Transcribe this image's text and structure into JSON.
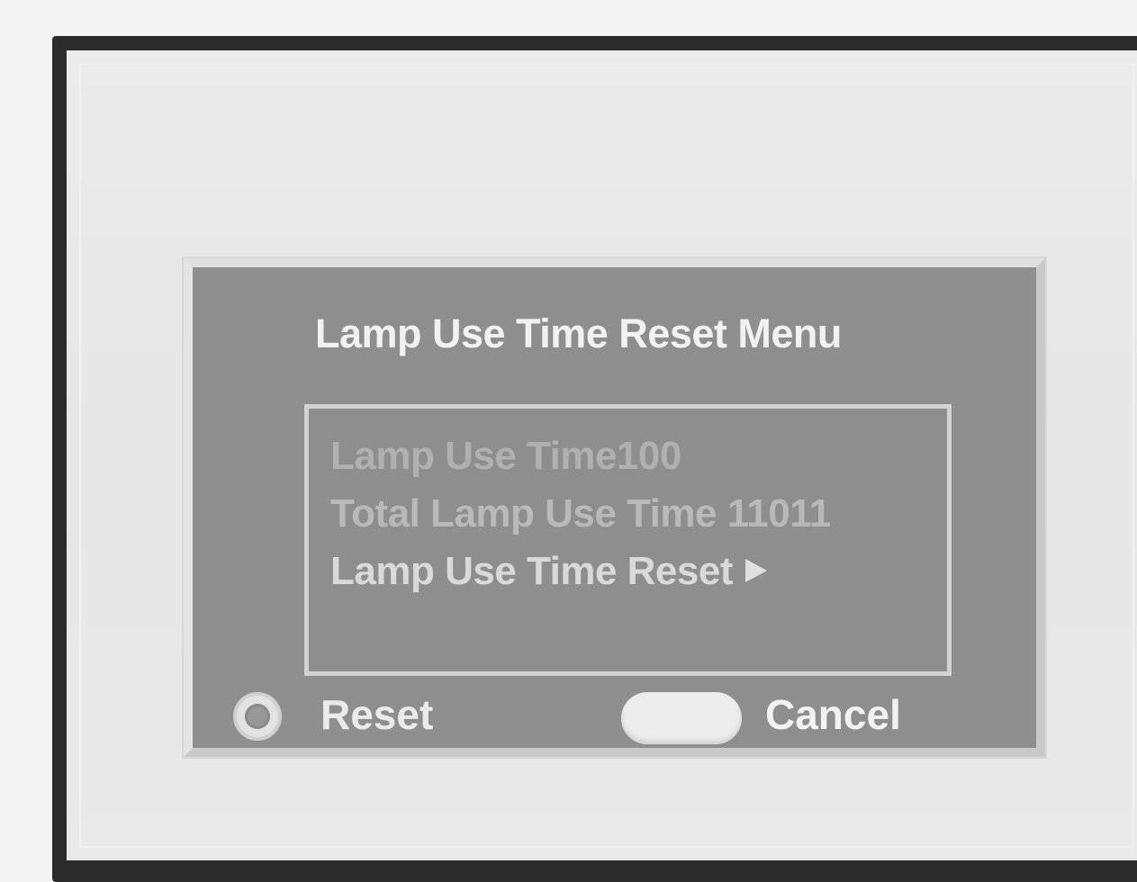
{
  "dialog": {
    "title": "Lamp Use Time Reset Menu",
    "rows": [
      {
        "label": "Lamp Use Time100"
      },
      {
        "label": "Total Lamp Use Time 11011"
      },
      {
        "label": "Lamp Use Time Reset"
      }
    ],
    "selected_row_icon": "right-triangle-icon"
  },
  "footer": {
    "reset_label": "Reset",
    "reset_icon": "ok-circle-icon",
    "cancel_label": "Cancel",
    "cancel_icon": "pill-button-icon"
  },
  "colors": {
    "dialog_background": "#8e8e8e",
    "frame": "#2b2b2b",
    "screen": "#e8e8e8",
    "text": "#f1f1f1"
  }
}
